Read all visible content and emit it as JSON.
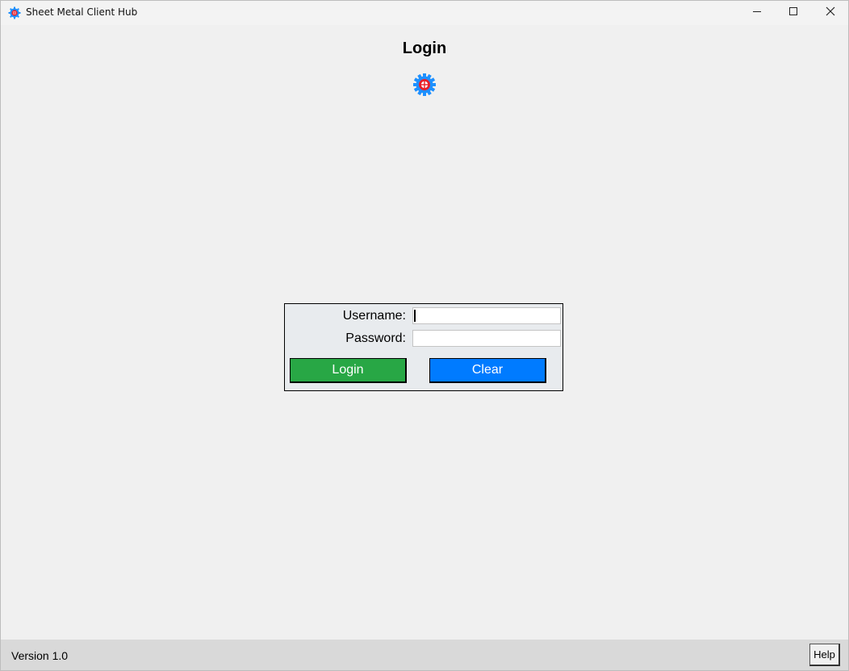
{
  "window": {
    "title": "Sheet Metal Client Hub",
    "controls": [
      "minimize-icon",
      "maximize-icon",
      "close-icon"
    ]
  },
  "header": {
    "title": "Login",
    "logo_icon": "gear-icon"
  },
  "login_form": {
    "username_label": "Username:",
    "username_value": "",
    "password_label": "Password:",
    "password_value": "",
    "login_label": "Login",
    "clear_label": "Clear"
  },
  "colors": {
    "login_button": "#28a745",
    "clear_button": "#007bff",
    "logo_gear": "#1e90ff",
    "logo_center": "#e8202a"
  },
  "statusbar": {
    "version": "Version 1.0",
    "help_label": "Help"
  }
}
